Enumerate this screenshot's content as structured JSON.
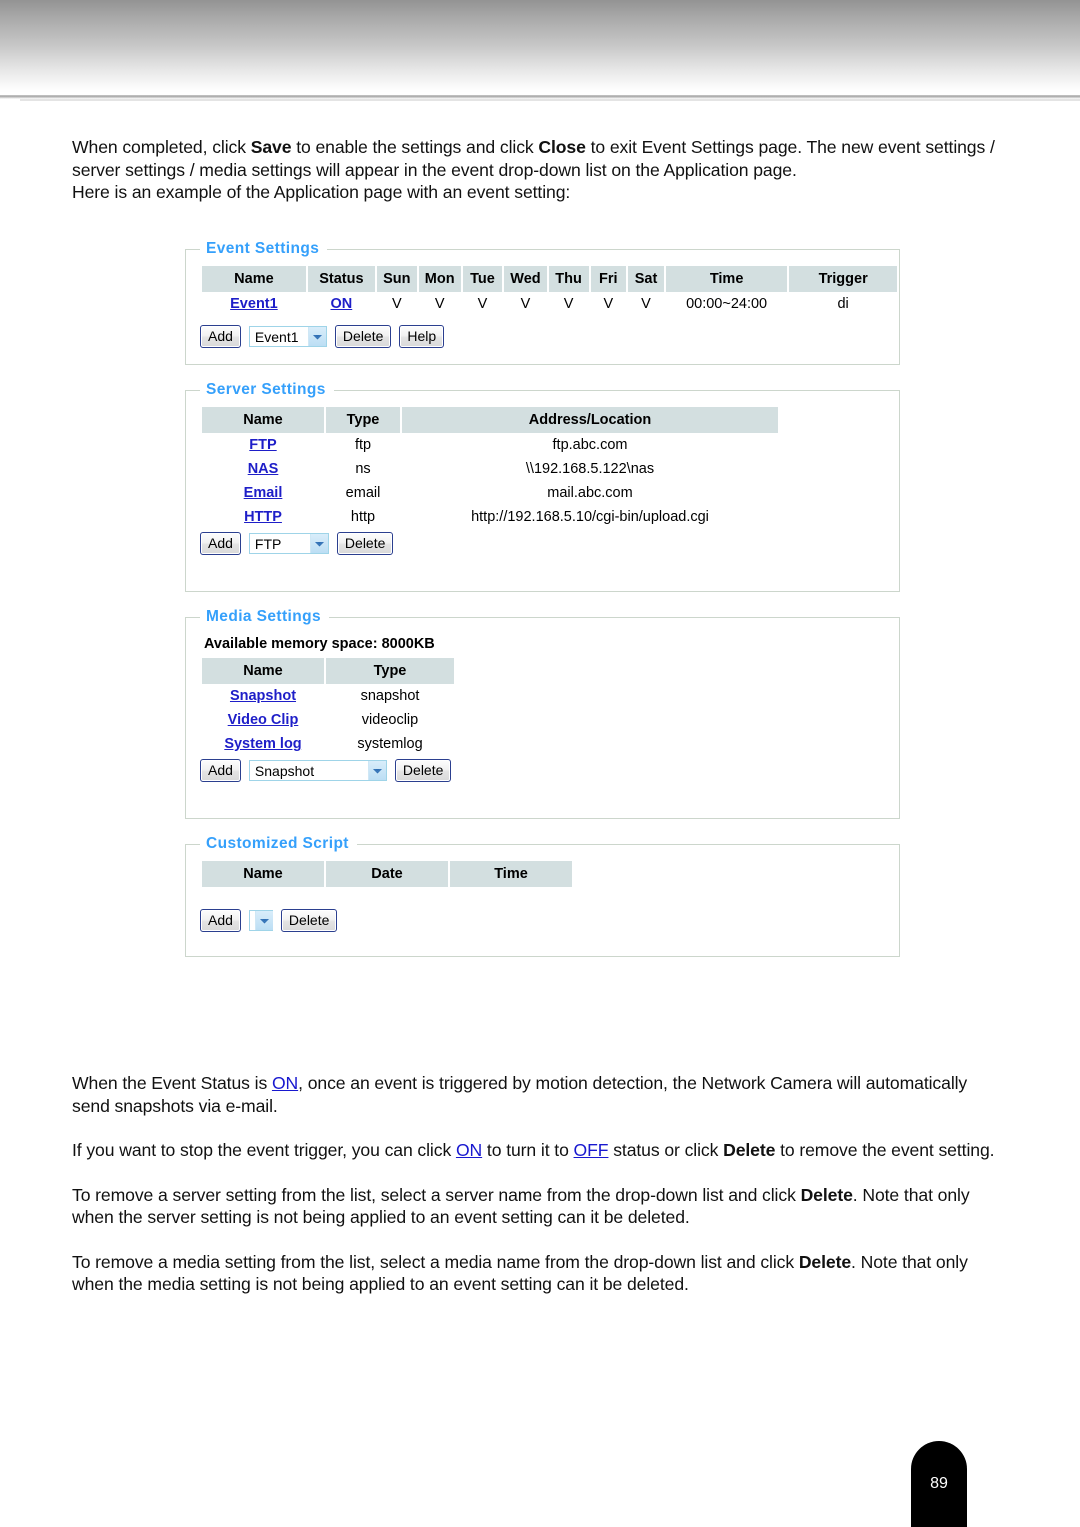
{
  "document": {
    "page_number": "89",
    "intro_paragraphs": [
      {
        "id": "p1",
        "runs": [
          {
            "t": "When completed, click ",
            "s": "normal"
          },
          {
            "t": "Save",
            "s": "bold"
          },
          {
            "t": " to enable the settings and click ",
            "s": "normal"
          },
          {
            "t": "Close",
            "s": "bold"
          },
          {
            "t": " to exit Event Settings page. The new event settings / server settings / media settings will appear in the event drop-down list on the Application page.",
            "s": "normal"
          }
        ]
      },
      {
        "id": "p2",
        "runs": [
          {
            "t": "Here is an example of the Application page with an event setting:",
            "s": "normal"
          }
        ]
      }
    ],
    "outro_paragraphs": [
      {
        "id": "p3",
        "runs": [
          {
            "t": "When the Event Status is ",
            "s": "normal"
          },
          {
            "t": "ON",
            "s": "link"
          },
          {
            "t": ", once an event is triggered by motion detection, the Network Camera will automatically send snapshots via e-mail.",
            "s": "normal"
          }
        ]
      },
      {
        "id": "p4",
        "runs": [
          {
            "t": "If you want to stop the event trigger, you can click ",
            "s": "normal"
          },
          {
            "t": "ON",
            "s": "link"
          },
          {
            "t": " to turn it to ",
            "s": "normal"
          },
          {
            "t": "OFF",
            "s": "link"
          },
          {
            "t": " status or click ",
            "s": "normal"
          },
          {
            "t": "Delete",
            "s": "bold"
          },
          {
            "t": " to remove the event setting.",
            "s": "normal"
          }
        ]
      },
      {
        "id": "p5",
        "runs": [
          {
            "t": "To remove a server setting from the list, select a server name from the drop-down list and click ",
            "s": "normal"
          },
          {
            "t": "Delete",
            "s": "bold"
          },
          {
            "t": ". Note that only when the server setting is not being applied to an event setting can it be deleted.",
            "s": "normal"
          }
        ]
      },
      {
        "id": "p6",
        "runs": [
          {
            "t": "To remove a media setting from the list, select a media name from the drop-down list and click ",
            "s": "normal"
          },
          {
            "t": "Delete",
            "s": "bold"
          },
          {
            "t": ". Note that only when the media setting is not being applied to an event setting can it be deleted.",
            "s": "normal"
          }
        ]
      }
    ]
  },
  "colors": {
    "legend": "#35a0fb",
    "link": "#1e1ec8",
    "table_header_bg": "#d3dfe0",
    "panel_border": "#ccd6cc"
  },
  "event_settings": {
    "legend": "Event Settings",
    "columns": [
      "Name",
      "Status",
      "Sun",
      "Mon",
      "Tue",
      "Wed",
      "Thu",
      "Fri",
      "Sat",
      "Time",
      "Trigger"
    ],
    "rows": [
      {
        "name": "Event1",
        "status": "ON",
        "sun": "V",
        "mon": "V",
        "tue": "V",
        "wed": "V",
        "thu": "V",
        "fri": "V",
        "sat": "V",
        "time": "00:00~24:00",
        "trigger": "di"
      }
    ],
    "controls": {
      "add_label": "Add",
      "select_value": "Event1",
      "delete_label": "Delete",
      "help_label": "Help"
    }
  },
  "server_settings": {
    "legend": "Server Settings",
    "columns": [
      "Name",
      "Type",
      "Address/Location"
    ],
    "rows": [
      {
        "name": "FTP",
        "type": "ftp",
        "address": "ftp.abc.com"
      },
      {
        "name": "NAS",
        "type": "ns",
        "address": "\\\\192.168.5.122\\nas"
      },
      {
        "name": "Email",
        "type": "email",
        "address": "mail.abc.com"
      },
      {
        "name": "HTTP",
        "type": "http",
        "address": "http://192.168.5.10/cgi-bin/upload.cgi"
      }
    ],
    "controls": {
      "add_label": "Add",
      "select_value": "FTP",
      "delete_label": "Delete"
    }
  },
  "media_settings": {
    "legend": "Media Settings",
    "memory_text": "Available memory space: 8000KB",
    "columns": [
      "Name",
      "Type"
    ],
    "rows": [
      {
        "name": "Snapshot",
        "type": "snapshot"
      },
      {
        "name": "Video Clip",
        "type": "videoclip"
      },
      {
        "name": "System log",
        "type": "systemlog"
      }
    ],
    "controls": {
      "add_label": "Add",
      "select_value": "Snapshot",
      "delete_label": "Delete"
    }
  },
  "customized_script": {
    "legend": "Customized Script",
    "columns": [
      "Name",
      "Date",
      "Time"
    ],
    "rows": [],
    "controls": {
      "add_label": "Add",
      "select_value": "",
      "delete_label": "Delete"
    }
  }
}
